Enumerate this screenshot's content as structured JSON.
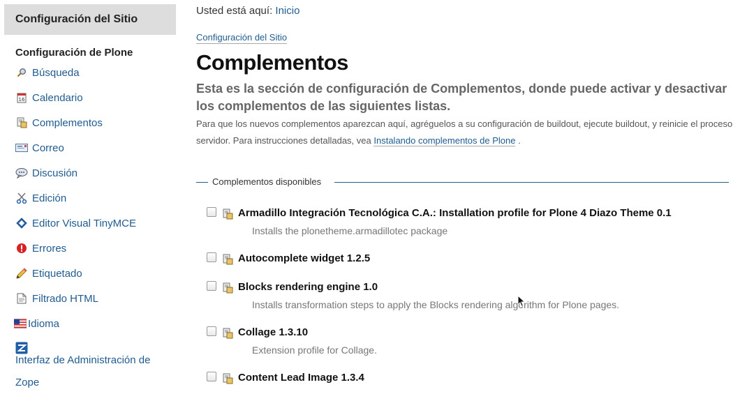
{
  "sidebar": {
    "header": "Configuración del Sitio",
    "section_title": "Configuración de Plone",
    "items": [
      {
        "label": "Búsqueda",
        "icon": "search-icon"
      },
      {
        "label": "Calendario",
        "icon": "calendar-icon"
      },
      {
        "label": "Complementos",
        "icon": "product-icon"
      },
      {
        "label": "Correo",
        "icon": "mail-icon"
      },
      {
        "label": "Discusión",
        "icon": "discussion-icon"
      },
      {
        "label": "Edición",
        "icon": "scissors-icon"
      },
      {
        "label": "Editor Visual TinyMCE",
        "icon": "tinymce-icon"
      },
      {
        "label": "Errores",
        "icon": "error-icon"
      },
      {
        "label": "Etiquetado",
        "icon": "pencil-icon"
      },
      {
        "label": "Filtrado HTML",
        "icon": "document-icon"
      },
      {
        "label": "Idioma",
        "icon": "flag-icon"
      },
      {
        "label": "Interfaz de Administración de Zope",
        "icon": "zope-icon"
      }
    ]
  },
  "breadcrumb": {
    "prefix": "Usted está aquí:",
    "home": "Inicio"
  },
  "main": {
    "section_link": "Configuración del Sitio",
    "title": "Complementos",
    "lead": "Esta es la sección de configuración de Complementos, donde puede activar y desactivar los complementos de las siguientes listas.",
    "description_before": "Para que los nuevos complementos aparezcan aquí, agréguelos a su configuración de buildout, ejecute buildout, y reinicie el proceso servidor. Para instrucciones detalladas, vea",
    "description_link": "Instalando complementos de Plone",
    "description_after": ".",
    "fieldset_legend": "Complementos disponibles"
  },
  "addons": [
    {
      "name": "Armadillo Integración Tecnológica C.A.: Installation profile for Plone 4 Diazo Theme 0.1",
      "description": "Installs the plonetheme.armadillotec package",
      "checked": false
    },
    {
      "name": "Autocomplete widget 1.2.5",
      "description": "",
      "checked": false
    },
    {
      "name": "Blocks rendering engine 1.0",
      "description": "Installs transformation steps to apply the Blocks rendering algorithm for Plone pages.",
      "checked": false
    },
    {
      "name": "Collage 1.3.10",
      "description": "Extension profile for Collage.",
      "checked": false
    },
    {
      "name": "Content Lead Image 1.3.4",
      "description": "",
      "checked": false
    }
  ],
  "colors": {
    "link": "#205c90",
    "sidebar_header_bg": "#dddddd"
  }
}
